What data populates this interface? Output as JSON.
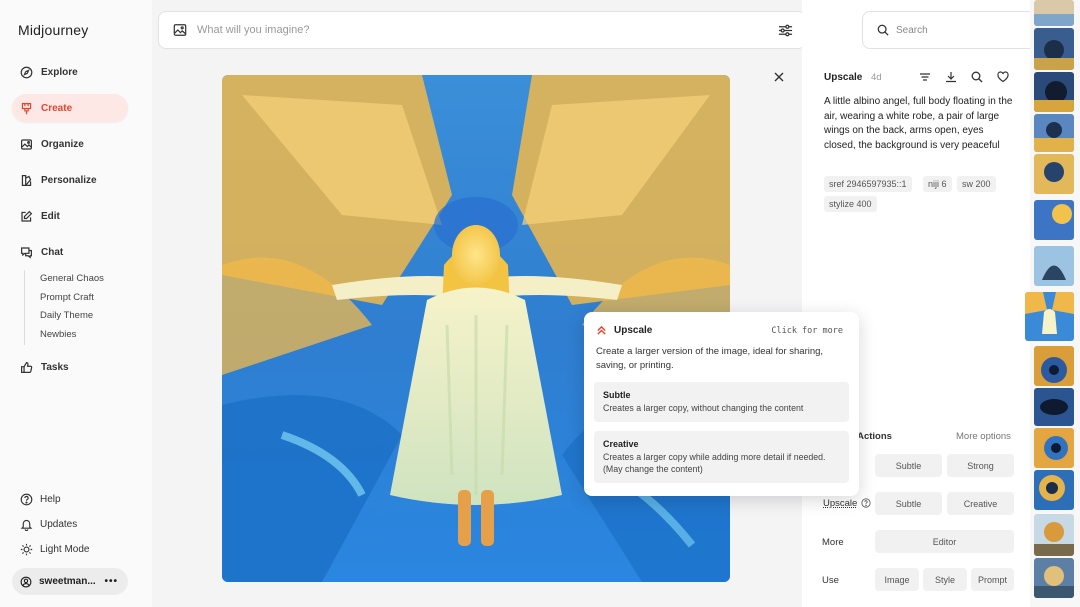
{
  "app": {
    "logo": "Midjourney"
  },
  "sidebar": {
    "nav": [
      {
        "label": "Explore",
        "icon": "compass-icon"
      },
      {
        "label": "Create",
        "icon": "brush-icon",
        "active": true
      },
      {
        "label": "Organize",
        "icon": "image-icon"
      },
      {
        "label": "Personalize",
        "icon": "palette-icon"
      },
      {
        "label": "Edit",
        "icon": "edit-icon"
      },
      {
        "label": "Chat",
        "icon": "chat-icon"
      }
    ],
    "chat_rooms": [
      "General Chaos",
      "Prompt Craft",
      "Daily Theme",
      "Newbies"
    ],
    "tasks": "Tasks",
    "help": "Help",
    "updates": "Updates",
    "light_mode": "Light Mode",
    "user": "sweetman...",
    "user_menu": "•••",
    "accent": "#e0452f"
  },
  "imagine": {
    "placeholder": "What will you imagine?"
  },
  "search": {
    "placeholder": "Search"
  },
  "detail": {
    "title": "Upscale",
    "age": "4d",
    "prompt": "A little albino angel, full body floating in the air, wearing a white robe, a pair of large wings on the back, arms open, eyes closed, the background is very peaceful",
    "tags": [
      "sref 2946597935::1",
      "niji 6",
      "sw 200",
      "stylize 400"
    ],
    "actions_header": "n Actions",
    "more_options": "More options",
    "vary": {
      "subtle": "Subtle",
      "strong": "Strong"
    },
    "upscale": {
      "label": "Upscale",
      "subtle": "Subtle",
      "creative": "Creative"
    },
    "more": {
      "label": "More",
      "editor": "Editor"
    },
    "use": {
      "label": "Use",
      "image": "Image",
      "style": "Style",
      "prompt": "Prompt"
    }
  },
  "tooltip": {
    "title": "Upscale",
    "click_hint": "Click for more",
    "description": "Create a larger version of the image, ideal for sharing, saving, or printing.",
    "options": [
      {
        "title": "Subtle",
        "desc": "Creates a larger copy, without changing the content"
      },
      {
        "title": "Creative",
        "desc": "Creates a larger copy while adding more detail if needed. (May change the content)"
      }
    ]
  }
}
